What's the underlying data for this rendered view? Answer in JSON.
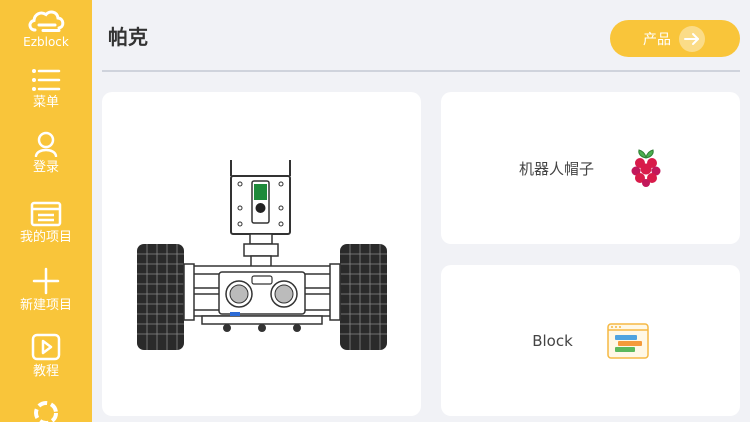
{
  "sidebar": {
    "brand": {
      "label": "Ezblock",
      "icon": "cloud-logo-icon"
    },
    "items": [
      {
        "label": "菜单",
        "icon": "menu-icon"
      },
      {
        "label": "登录",
        "icon": "user-icon"
      },
      {
        "label": "我的项目",
        "icon": "project-folder-icon"
      },
      {
        "label": "新建项目",
        "icon": "plus-icon"
      },
      {
        "label": "教程",
        "icon": "play-icon"
      }
    ],
    "partial_icon": "settings-gear-icon",
    "color": "#f9c53a"
  },
  "header": {
    "title": "帕克",
    "product_button_label": "产品",
    "product_button_icon": "arrow-right-icon"
  },
  "cards": {
    "robot": {
      "image": "robot-car-picarx-illustration"
    },
    "hat": {
      "label": "机器人帽子",
      "icon": "raspberry-pi-icon"
    },
    "block": {
      "label": "Block",
      "icon": "block-editor-icon"
    }
  }
}
